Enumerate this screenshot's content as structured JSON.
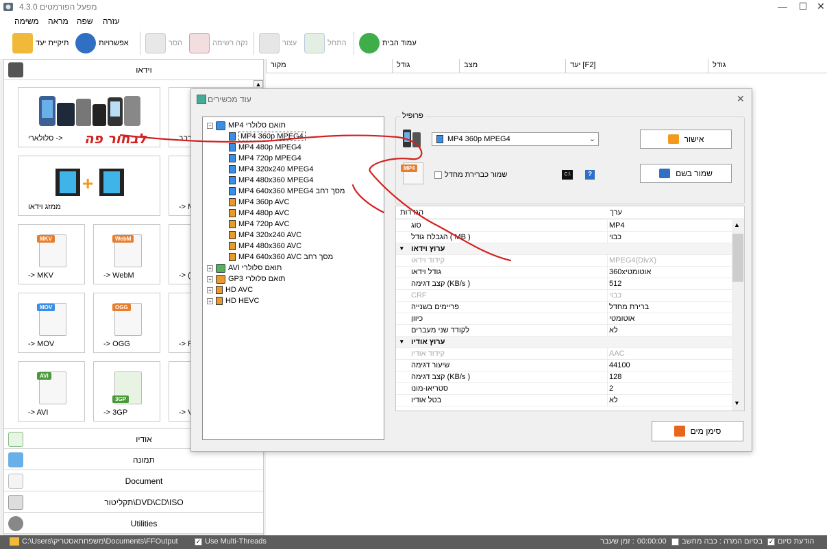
{
  "window": {
    "title": "מפעל הפורמטים 4.3.0"
  },
  "menu": [
    "עזרה",
    "שפה",
    "מראה",
    "משימה"
  ],
  "toolbar": {
    "home": "עמוד הבית",
    "start": "התחל",
    "stop": "עצור",
    "clear": "נקה רשימה",
    "remove": "הסר",
    "options": "אפשרויות",
    "output": "תיקיית יעד"
  },
  "filelist": {
    "columns": [
      "מקור",
      "גודל",
      "מצב",
      "יעד [F2]",
      "גודל"
    ]
  },
  "left": {
    "video_header": "וידאו",
    "tiles": {
      "mobile": "סלולארי ->",
      "mobile_annotation": "לבחור פה",
      "multi": "רבב",
      "joiner": "ממזג וידאו",
      "mkv": "-> MKV",
      "webm": "-> WebM",
      "mov": "-> MOV",
      "ogg": "-> OGG",
      "avi": "-> AVI",
      "3gp": "-> 3GP",
      "p1": "-> M",
      "p2": "-> (",
      "p3": "-> F",
      "p4": "-> V"
    },
    "badges": {
      "mkv": "MKV",
      "webm": "WebM",
      "mov": "MOV",
      "ogg": "OGG",
      "avi": "AVI",
      "3gp": "3GP"
    },
    "categories": [
      "אודיו",
      "תמונה",
      "Document",
      "תקליטור\\DVD\\CD\\ISO",
      "Utilities"
    ]
  },
  "dialog": {
    "title": "עוד מכשירים",
    "tree": {
      "root": "MP4 תואם סלולרי",
      "children": [
        "MP4 360p MPEG4",
        "MP4 480p MPEG4",
        "MP4 720p MPEG4",
        "MP4 320x240 MPEG4",
        "MP4 480x360 MPEG4",
        "MP4 640x360 MPEG4 מסך רחב",
        "MP4 360p AVC",
        "MP4 480p AVC",
        "MP4 720p AVC",
        "MP4 320x240 AVC",
        "MP4 480x360 AVC",
        "MP4 640x360 AVC מסך רחב"
      ],
      "others": [
        "AVI תואם סלולרי",
        "GPתואם סלולרי 3",
        "HD AVC",
        "HD HEVC"
      ]
    },
    "profile_label": "פרופיל",
    "profile_value": "MP4 360p MPEG4",
    "ok": "אישור",
    "save_as": "שמור בשם",
    "save_default": "שמור כברירת מחדל",
    "mp4_badge": "MP4",
    "cmd_badge": "C:\\",
    "help": "?",
    "watermark": "סימן מים",
    "grid_head": {
      "name": "הגדרות",
      "value": "ערך"
    },
    "grid_rows": [
      {
        "k": "סוג",
        "v": "MP4",
        "t": "n"
      },
      {
        "k": "הגבלת גודל ( MB )",
        "v": "כבוי",
        "t": "n"
      },
      {
        "k": "ערוץ וידאו",
        "v": "",
        "t": "s"
      },
      {
        "k": "קידוד וידאו",
        "v": "MPEG4(DivX)",
        "t": "d"
      },
      {
        "k": "גודל וידאו",
        "v": "360xאוטומטי",
        "t": "n"
      },
      {
        "k": "קצב דגימה (KB/s )",
        "v": "512",
        "t": "n"
      },
      {
        "k": "CRF",
        "v": "כבוי",
        "t": "d"
      },
      {
        "k": "פריימים בשנייה",
        "v": "ברירת מחדל",
        "t": "n"
      },
      {
        "k": "כיוון",
        "v": "אוטומטי",
        "t": "n"
      },
      {
        "k": "לקודד שני מעברים",
        "v": "לא",
        "t": "n"
      },
      {
        "k": "ערוץ אודיו",
        "v": "",
        "t": "s"
      },
      {
        "k": "קידוד אודיו",
        "v": "AAC",
        "t": "d"
      },
      {
        "k": "שיעור דגימה",
        "v": "44100",
        "t": "n"
      },
      {
        "k": "קצב דגימה (KB/s )",
        "v": "128",
        "t": "n"
      },
      {
        "k": "סטריאו-מונו",
        "v": "2",
        "t": "n"
      },
      {
        "k": "בטל אודיו",
        "v": "לא",
        "t": "n"
      }
    ]
  },
  "status": {
    "path": "C:\\Users\\משפחתאסטריק\\Documents\\FFOutput",
    "multithread": "Use Multi-Threads",
    "elapsed_label": "זמן שעבר :",
    "elapsed": "00:00:00",
    "after_convert": "בסיום המרה : כבה מחשב",
    "notify": "הודעת סיום"
  },
  "colors": {
    "scribble": "#d42020",
    "accent": "#3a8ee6"
  }
}
